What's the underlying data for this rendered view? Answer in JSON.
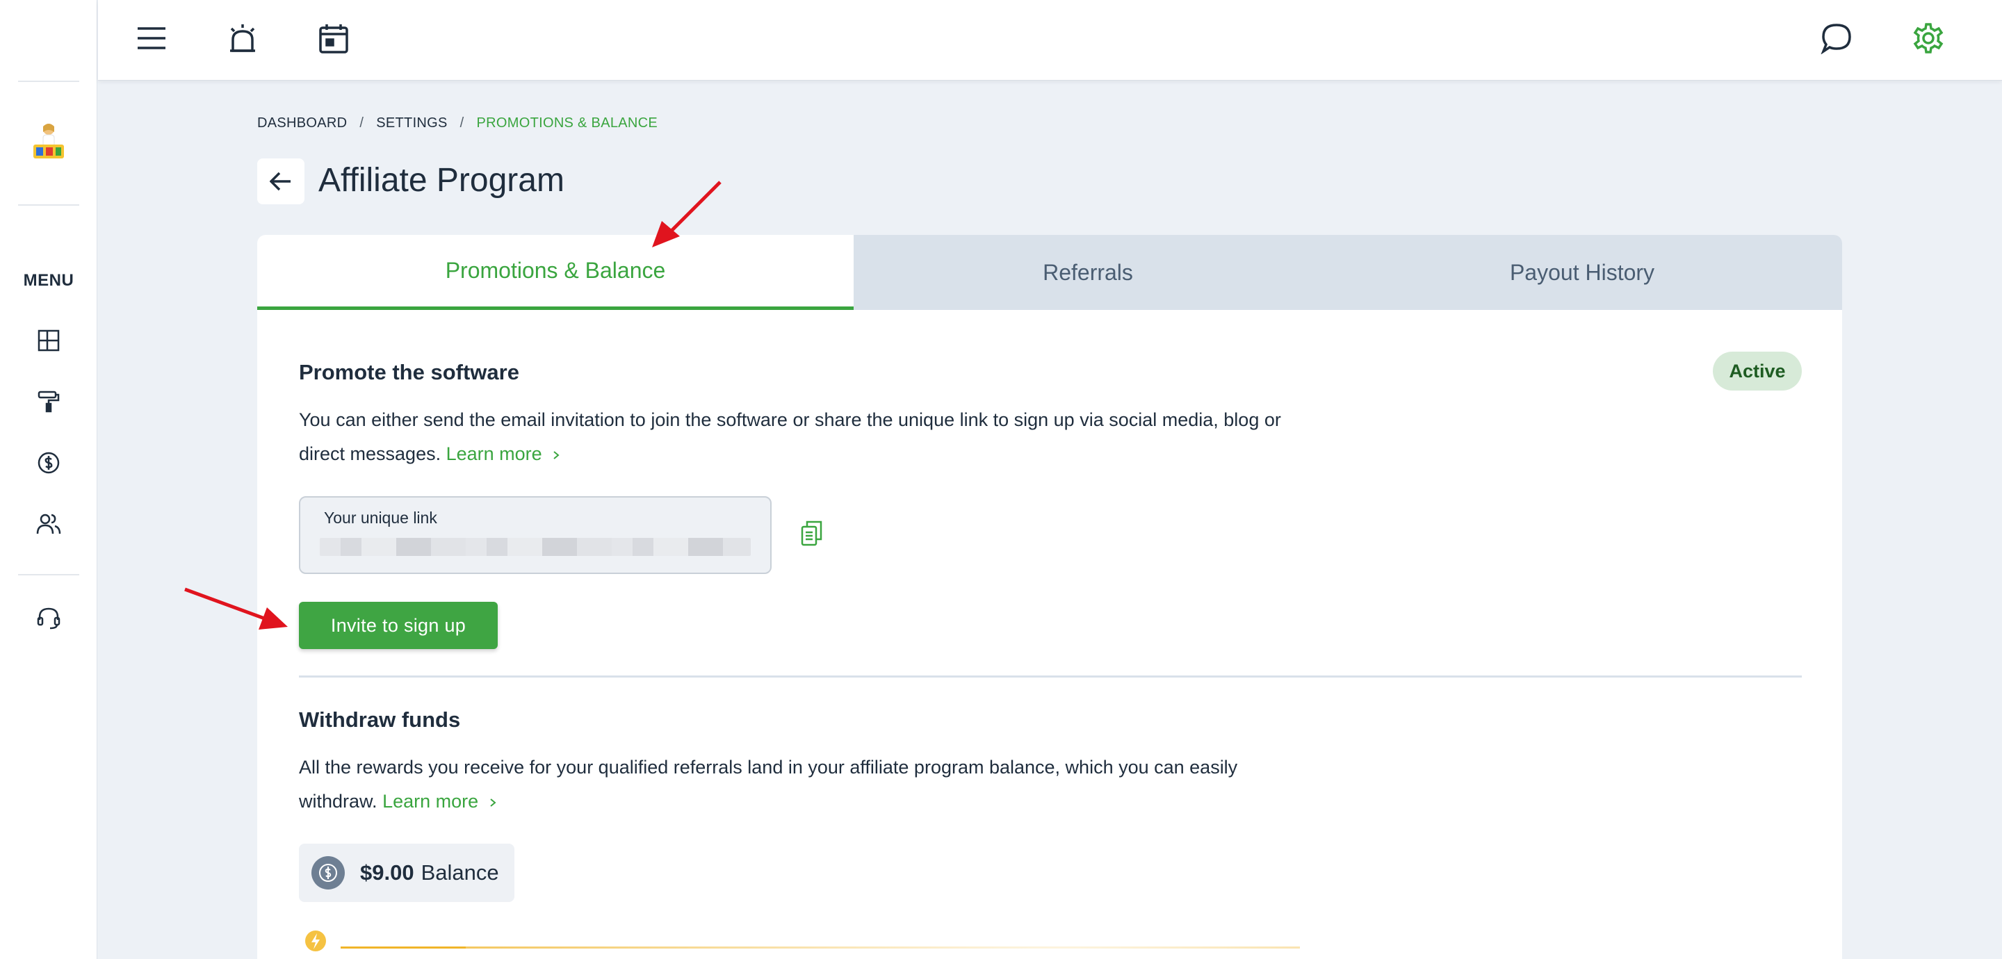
{
  "sidebar": {
    "menu_label": "MENU",
    "icons": [
      "dashboard-icon",
      "paint-roller-icon",
      "dollar-circle-icon",
      "users-icon",
      "headset-icon"
    ]
  },
  "topbar": {
    "icons": [
      "hamburger-icon",
      "alarm-icon",
      "calendar-icon",
      "chat-icon",
      "gear-icon"
    ],
    "accent": "#3aa53f"
  },
  "breadcrumb": {
    "items": [
      "DASHBOARD",
      "SETTINGS",
      "PROMOTIONS & BALANCE"
    ],
    "separator": "/"
  },
  "page": {
    "title": "Affiliate Program"
  },
  "tabs": [
    {
      "label": "Promotions & Balance",
      "active": true
    },
    {
      "label": "Referrals",
      "active": false
    },
    {
      "label": "Payout History",
      "active": false
    }
  ],
  "promote": {
    "title": "Promote the software",
    "status": "Active",
    "description": "You can either send the email invitation to join the software or share the unique link to sign up via social media, blog or direct messages.",
    "learn_more": "Learn more",
    "link_label": "Your unique link",
    "invite_button": "Invite to sign up"
  },
  "withdraw": {
    "title": "Withdraw funds",
    "description": "All the rewards you receive for your qualified referrals land in your affiliate program balance, which you can easily withdraw.",
    "learn_more": "Learn more",
    "balance_amount": "$9.00",
    "balance_label": "Balance"
  },
  "colors": {
    "brand_green": "#3aa53f",
    "tab_bg": "#d9e1ea",
    "page_bg": "#edf1f6",
    "status_badge_bg": "#d7ead8",
    "progress": "#f0b429"
  }
}
